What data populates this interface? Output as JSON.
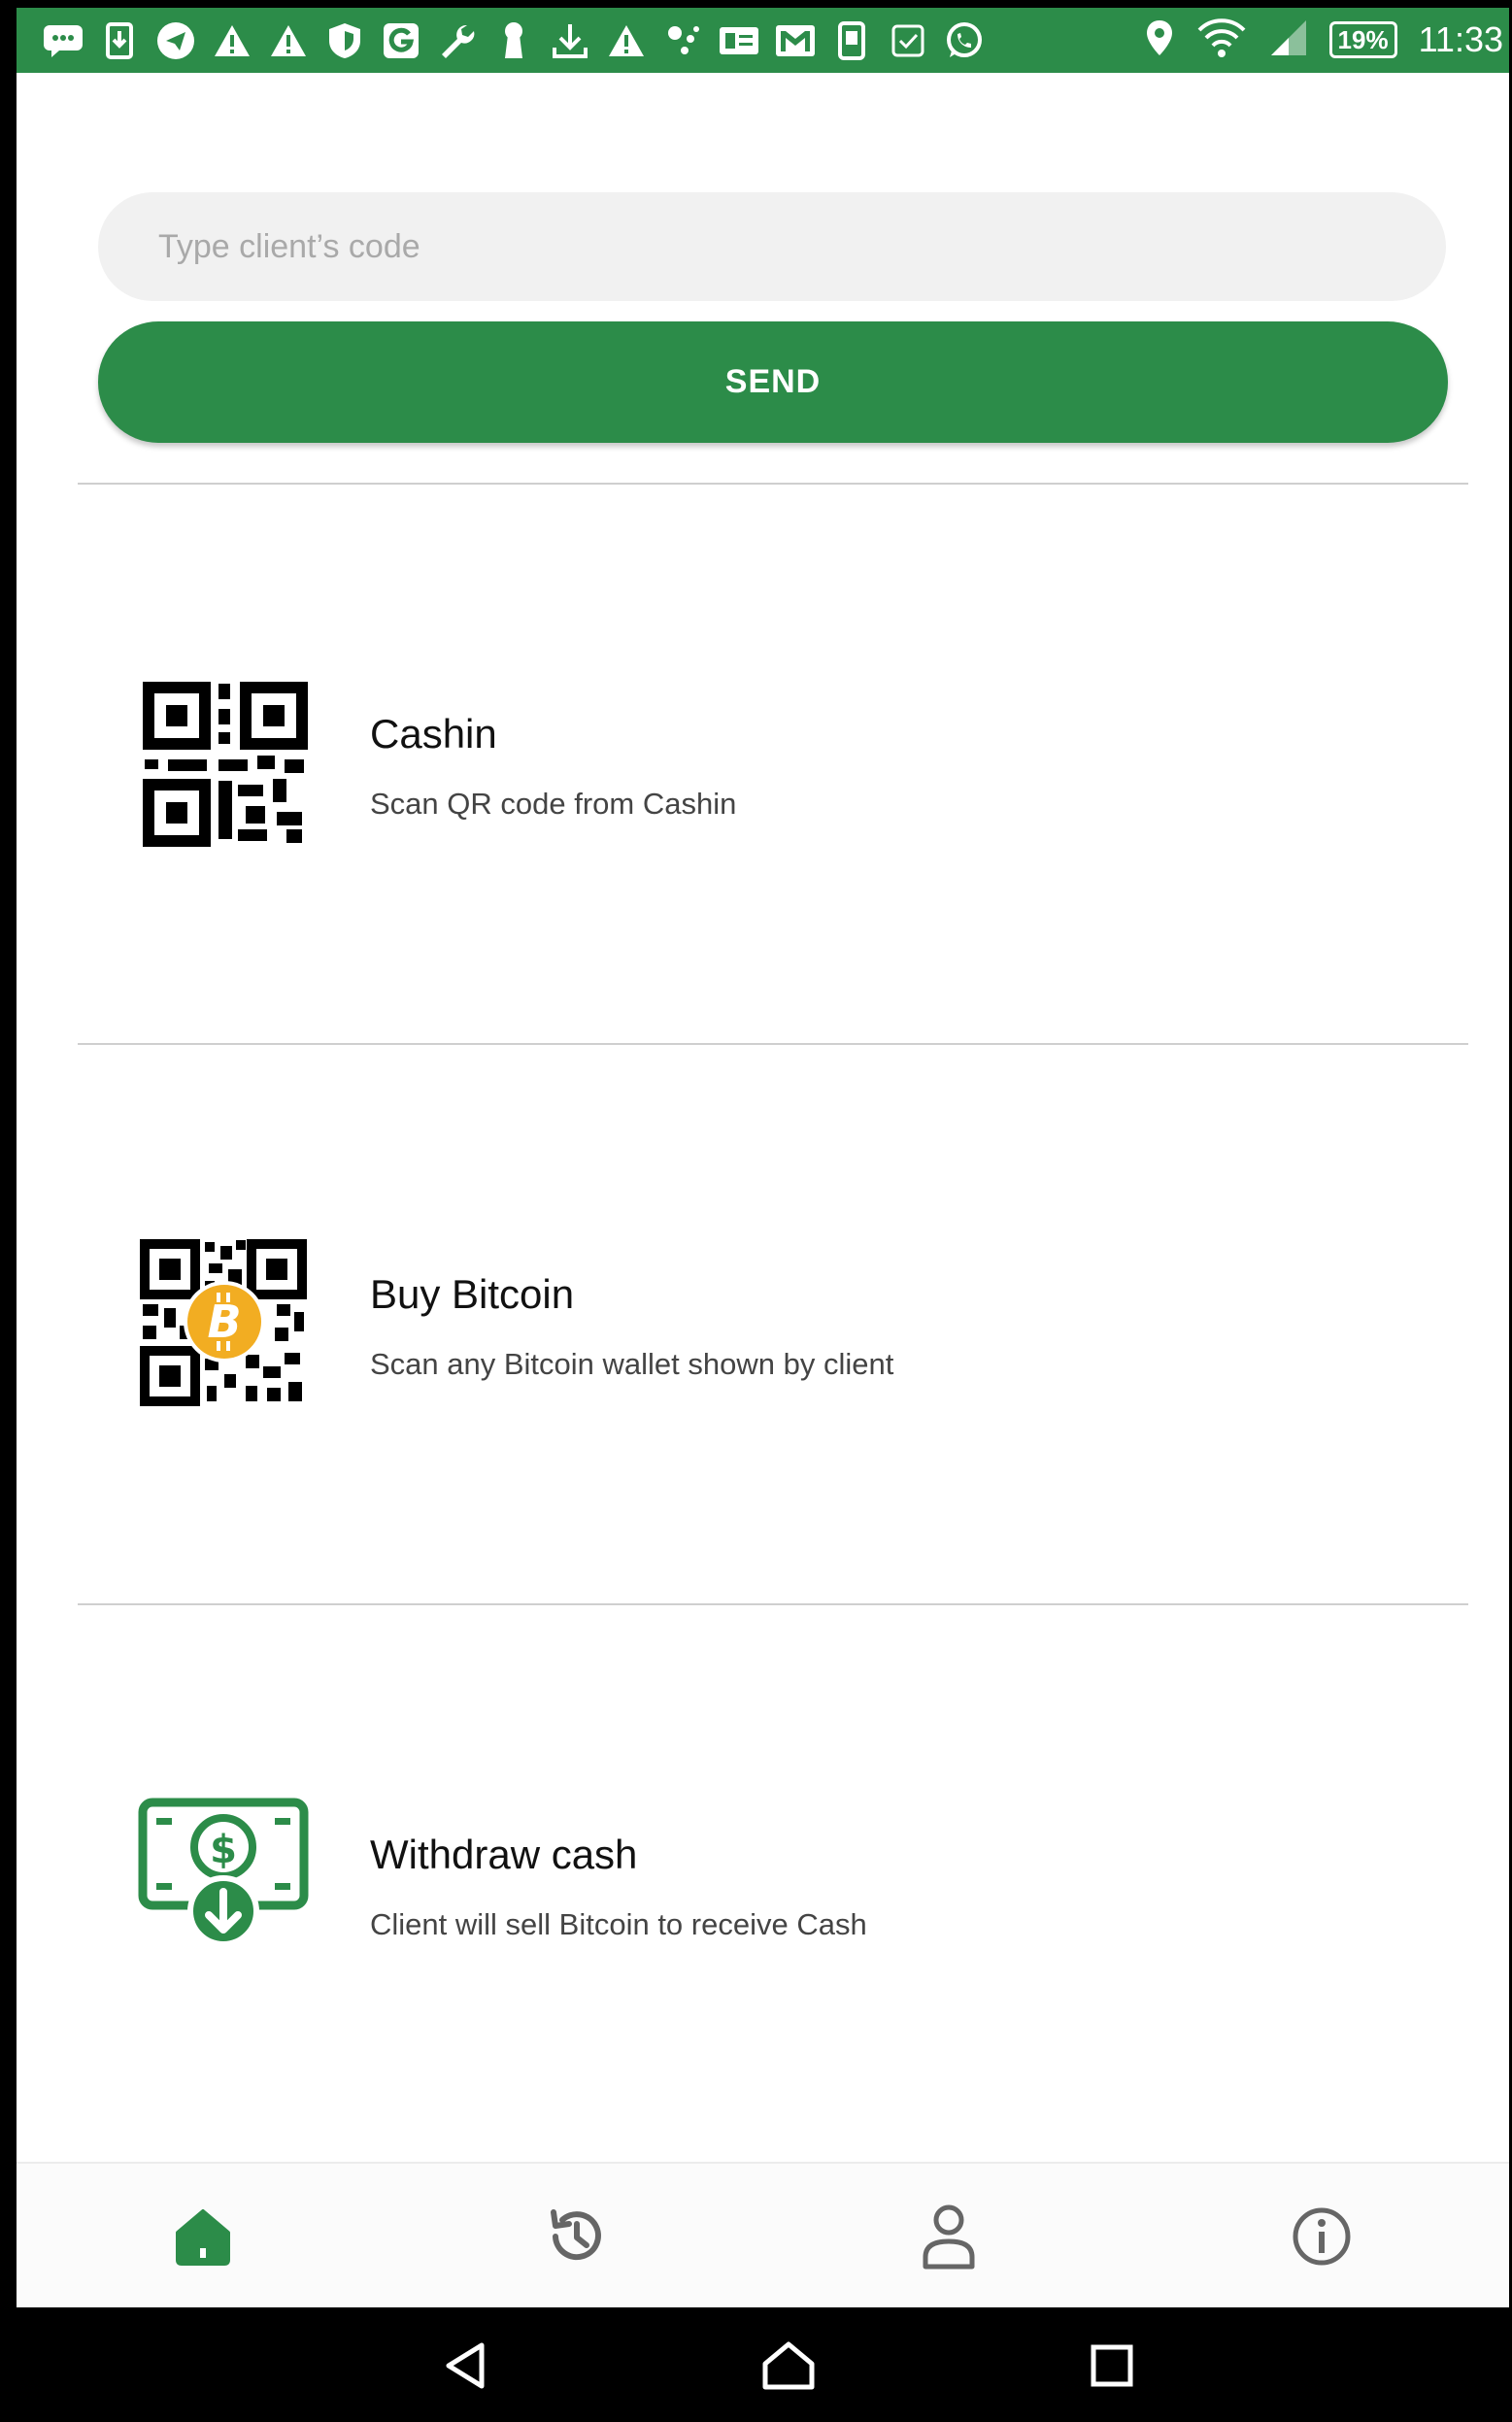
{
  "status_bar": {
    "battery": "19%",
    "time": "11:33",
    "left_icons": [
      "message-icon",
      "download-box-icon",
      "telegram-icon",
      "warning-icon",
      "warning-icon",
      "shield-icon",
      "g-app-icon",
      "wrench-icon",
      "keyhole-icon",
      "download-icon",
      "warning-icon",
      "dots-icon",
      "card-icon",
      "gmail-icon",
      "phone-icon",
      "checkbox-icon",
      "whatsapp-icon"
    ],
    "right_icons": [
      "location-icon",
      "wifi-icon",
      "signal-icon"
    ]
  },
  "code_form": {
    "placeholder": "Type client’s code",
    "value": "",
    "send_label": "SEND"
  },
  "actions": [
    {
      "title": "Cashin",
      "subtitle": "Scan QR code from Cashin",
      "icon": "qr-code-icon"
    },
    {
      "title": "Buy Bitcoin",
      "subtitle": "Scan any Bitcoin wallet shown by client",
      "icon": "bitcoin-qr-icon"
    },
    {
      "title": "Withdraw cash",
      "subtitle": "Client will sell Bitcoin to receive Cash",
      "icon": "withdraw-cash-icon"
    }
  ],
  "bottom_nav": [
    {
      "name": "home",
      "icon": "home-icon",
      "active": true
    },
    {
      "name": "history",
      "icon": "history-icon",
      "active": false
    },
    {
      "name": "profile",
      "icon": "user-icon",
      "active": false
    },
    {
      "name": "info",
      "icon": "info-icon",
      "active": false
    }
  ],
  "colors": {
    "accent": "#2c8c49",
    "bitcoin": "#f2ad22",
    "divider": "#cfcfcf",
    "input_bg": "#f1f1f1"
  }
}
